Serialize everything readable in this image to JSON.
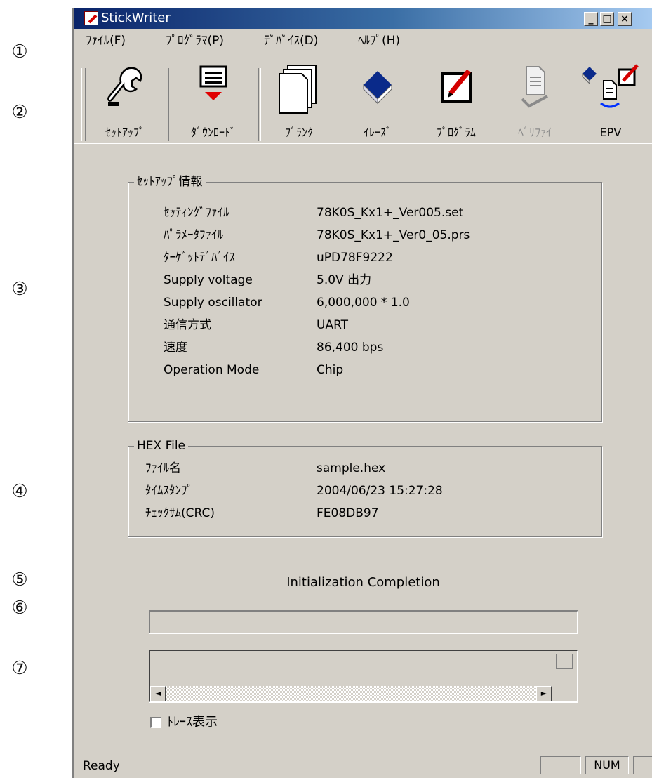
{
  "callouts": [
    "①",
    "②",
    "③",
    "④",
    "⑤",
    "⑥",
    "⑦"
  ],
  "window": {
    "title": "StickWriter",
    "min_btn": "_",
    "max_btn": "□",
    "close_btn": "×"
  },
  "menu": [
    {
      "label": "ﾌｧｲﾙ(F)"
    },
    {
      "label": "ﾌﾟﾛｸﾞﾗﾏ(P)"
    },
    {
      "label": "ﾃﾞﾊﾞｲｽ(D)"
    },
    {
      "label": "ﾍﾙﾌﾟ(H)"
    }
  ],
  "toolbar": [
    {
      "label": "ｾｯﾄｱｯﾌﾟ",
      "icon": "wrench-icon",
      "enabled": true
    },
    {
      "label": "ﾀﾞｳﾝﾛｰﾄﾞ",
      "icon": "download-icon",
      "enabled": true
    },
    {
      "label": "ﾌﾞﾗﾝｸ",
      "icon": "blank-pages-icon",
      "enabled": true
    },
    {
      "label": "ｲﾚｰｽﾞ",
      "icon": "eraser-icon",
      "enabled": true
    },
    {
      "label": "ﾌﾟﾛｸﾞﾗﾑ",
      "icon": "program-pencil-icon",
      "enabled": true
    },
    {
      "label": "ﾍﾞﾘﾌｧｲ",
      "icon": "verify-icon",
      "enabled": false
    },
    {
      "label": "EPV",
      "icon": "epv-icon",
      "enabled": true
    }
  ],
  "setup_info": {
    "title": "ｾｯﾄｱｯﾌﾟ情報",
    "rows": [
      {
        "label": "ｾｯﾃｨﾝｸﾞﾌｧｲﾙ",
        "value": "78K0S_Kx1+_Ver005.set"
      },
      {
        "label": "ﾊﾟﾗﾒｰﾀﾌｧｲﾙ",
        "value": "78K0S_Kx1+_Ver0_05.prs"
      },
      {
        "label": "ﾀｰｹﾞｯﾄﾃﾞﾊﾞｲｽ",
        "value": "uPD78F9222"
      },
      {
        "label": "Supply voltage",
        "value": "5.0V 出力"
      },
      {
        "label": "Supply oscillator",
        "value": "6,000,000 * 1.0"
      },
      {
        "label": "通信方式",
        "value": "UART"
      },
      {
        "label": "速度",
        "value": "86,400 bps"
      },
      {
        "label": "Operation Mode",
        "value": "Chip"
      }
    ]
  },
  "hex_file": {
    "title": "HEX File",
    "rows": [
      {
        "label": "ﾌｧｲﾙ名",
        "value": "sample.hex"
      },
      {
        "label": "ﾀｲﾑｽﾀﾝﾌﾟ",
        "value": "2004/06/23 15:27:28"
      },
      {
        "label": "ﾁｪｯｸｻﾑ(CRC)",
        "value": "FE08DB97"
      }
    ]
  },
  "status_message": "Initialization Completion",
  "progress_value": 0,
  "trace": {
    "checkbox_label": "ﾄﾚｰｽ表示",
    "checked": false,
    "left_arrow": "◄",
    "right_arrow": "►"
  },
  "statusbar": {
    "text": "Ready",
    "num": "NUM"
  }
}
